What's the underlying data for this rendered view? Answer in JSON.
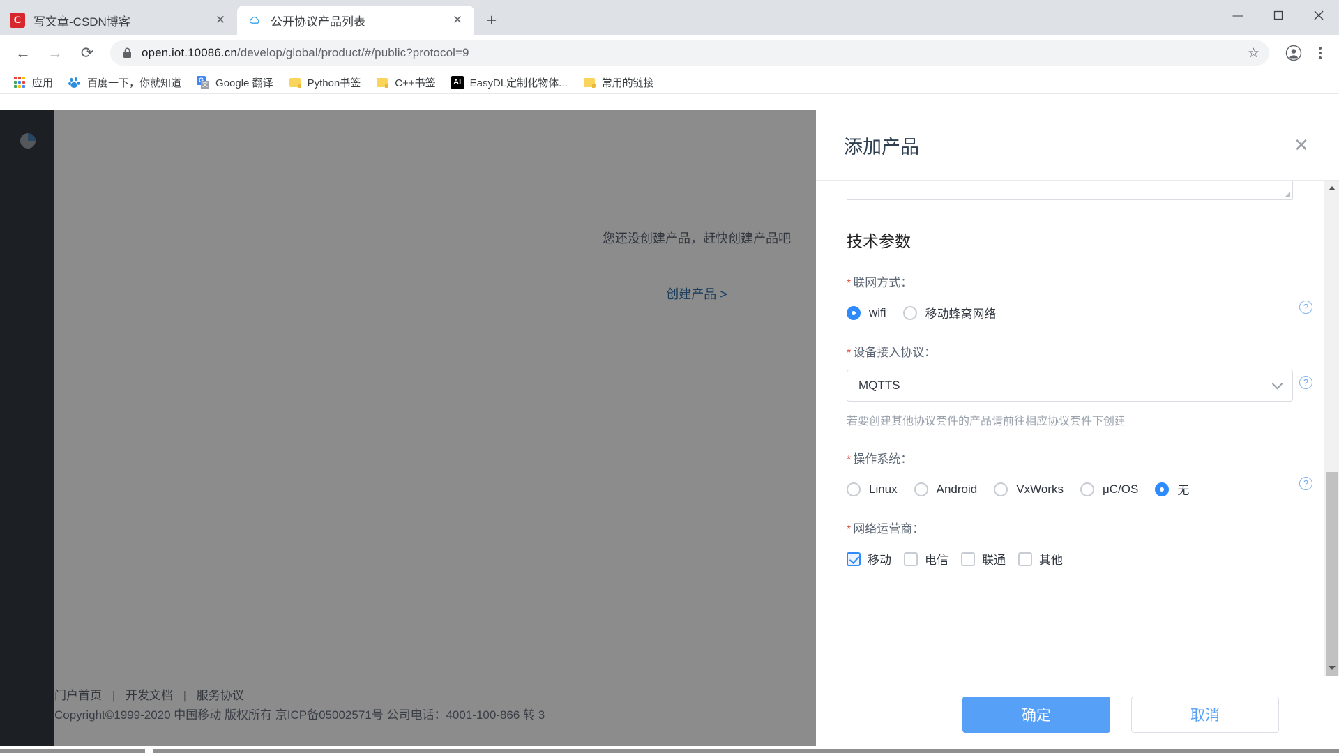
{
  "browser": {
    "tabs": [
      {
        "title": "写文章-CSDN博客",
        "favicon": "csdn-icon",
        "active": false
      },
      {
        "title": "公开协议产品列表",
        "favicon": "cloud-icon",
        "active": true
      }
    ],
    "newtab_label": "+",
    "window_controls": {
      "minimize": "—",
      "maximize": "❐",
      "close": "✕"
    },
    "nav": {
      "back": "←",
      "forward": "→",
      "reload": "⟳"
    },
    "omnibox": {
      "lock_icon": "lock-icon",
      "url_host": "open.iot.10086.cn",
      "url_path": "/develop/global/product/#/public?protocol=9",
      "star_icon": "star-icon",
      "profile_icon": "profile-icon",
      "menu_icon": "three-dots-icon"
    },
    "bookmarks": [
      {
        "label": "应用",
        "icon": "apps-grid-icon"
      },
      {
        "label": "百度一下，你就知道",
        "icon": "baidu-icon"
      },
      {
        "label": "Google 翻译",
        "icon": "google-translate-icon"
      },
      {
        "label": "Python书签",
        "icon": "folder-icon"
      },
      {
        "label": "C++书签",
        "icon": "folder-icon"
      },
      {
        "label": "EasyDL定制化物体...",
        "icon": "easydl-icon"
      },
      {
        "label": "常用的链接",
        "icon": "folder-icon"
      }
    ]
  },
  "page": {
    "sidebar_icon": "pie-chart-icon",
    "empty_message": "您还没创建产品，赶快创建产品吧",
    "empty_link": "创建产品 >",
    "footer": {
      "links": [
        "门户首页",
        "开发文档",
        "服务协议"
      ],
      "separator": "|",
      "copyright": "Copyright©1999-2020 中国移动 版权所有 京ICP备05002571号 公司电话：4001-100-866 转 3"
    }
  },
  "modal": {
    "title": "添加产品",
    "close_icon": "close-icon",
    "section_title": "技术参数",
    "fields": {
      "network_mode": {
        "label": "联网方式：",
        "required_mark": "*",
        "options": [
          {
            "label": "wifi",
            "selected": true
          },
          {
            "label": "移动蜂窝网络",
            "selected": false
          }
        ],
        "help_icon": "help-icon"
      },
      "access_protocol": {
        "label": "设备接入协议：",
        "required_mark": "*",
        "value": "MQTTS",
        "caret_icon": "chevron-down-icon",
        "hint": "若要创建其他协议套件的产品请前往相应协议套件下创建",
        "help_icon": "help-icon"
      },
      "operating_system": {
        "label": "操作系统：",
        "required_mark": "*",
        "options": [
          {
            "label": "Linux",
            "selected": false
          },
          {
            "label": "Android",
            "selected": false
          },
          {
            "label": "VxWorks",
            "selected": false
          },
          {
            "label": "μC/OS",
            "selected": false
          },
          {
            "label": "无",
            "selected": true
          }
        ],
        "help_icon": "help-icon"
      },
      "network_operator": {
        "label": "网络运营商：",
        "required_mark": "*",
        "options": [
          {
            "label": "移动",
            "checked": true
          },
          {
            "label": "电信",
            "checked": false
          },
          {
            "label": "联通",
            "checked": false
          },
          {
            "label": "其他",
            "checked": false
          }
        ]
      }
    },
    "scrollbar": {
      "up_icon": "arrow-up-icon",
      "down_icon": "arrow-down-icon"
    },
    "buttons": {
      "confirm": "确定",
      "cancel": "取消"
    }
  },
  "colors": {
    "accent_blue": "#56a0f8",
    "radio_on": "#2f8bfb",
    "required_red": "#e74c3c",
    "sidebar_dark": "#333942",
    "link_blue": "#2f6fab"
  }
}
